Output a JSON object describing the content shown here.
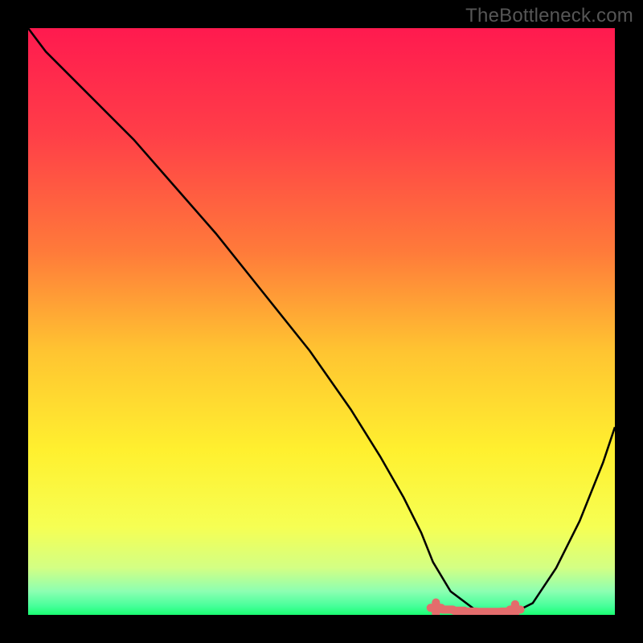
{
  "watermark": "TheBottleneck.com",
  "colors": {
    "background": "#000000",
    "gradient_stops": [
      {
        "offset": 0.0,
        "color": "#ff1a4f"
      },
      {
        "offset": 0.18,
        "color": "#ff3e48"
      },
      {
        "offset": 0.38,
        "color": "#ff7a3a"
      },
      {
        "offset": 0.55,
        "color": "#ffc431"
      },
      {
        "offset": 0.72,
        "color": "#fff02f"
      },
      {
        "offset": 0.85,
        "color": "#f6ff53"
      },
      {
        "offset": 0.92,
        "color": "#d3ff84"
      },
      {
        "offset": 0.96,
        "color": "#8cffb2"
      },
      {
        "offset": 0.985,
        "color": "#46ff9a"
      },
      {
        "offset": 1.0,
        "color": "#1aff72"
      }
    ],
    "curve": "#000000",
    "marker": "#e46c6c"
  },
  "chart_data": {
    "type": "line",
    "title": "",
    "xlabel": "",
    "ylabel": "",
    "xlim": [
      0,
      100
    ],
    "ylim": [
      0,
      100
    ],
    "grid": false,
    "series": [
      {
        "name": "curve",
        "x": [
          0,
          3,
          8,
          12,
          18,
          25,
          32,
          40,
          48,
          55,
          60,
          64,
          67,
          69,
          72,
          76,
          80,
          83,
          86,
          90,
          94,
          98,
          100
        ],
        "y": [
          100,
          96,
          91,
          87,
          81,
          73,
          65,
          55,
          45,
          35,
          27,
          20,
          14,
          9,
          4,
          1,
          0.5,
          0.5,
          2,
          8,
          16,
          26,
          32
        ]
      }
    ],
    "markers": {
      "name": "valley",
      "x": [
        69.5,
        71.5,
        73.5,
        75.5,
        77.5,
        79.5,
        81.5,
        83.0
      ],
      "y": [
        1.2,
        0.9,
        0.7,
        0.55,
        0.5,
        0.5,
        0.55,
        0.9
      ]
    }
  }
}
